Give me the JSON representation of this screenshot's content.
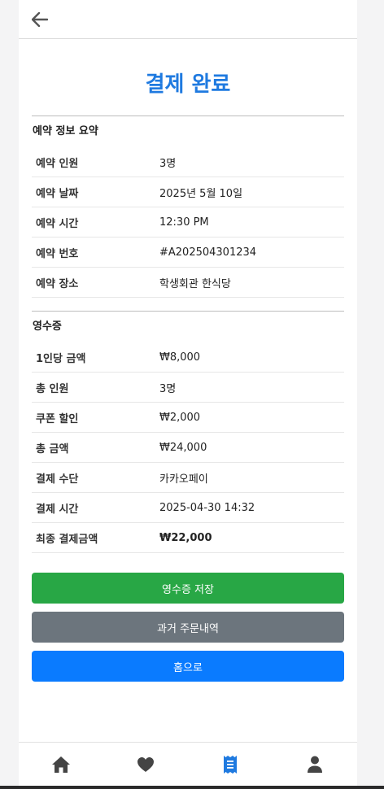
{
  "header": {
    "back_icon": "arrow-left-icon"
  },
  "page": {
    "title": "결제 완료"
  },
  "reservation": {
    "title": "예약 정보 요약",
    "rows": [
      {
        "label": "예약 인원",
        "value": "3명"
      },
      {
        "label": "예약 날짜",
        "value": "2025년 5월 10일"
      },
      {
        "label": "예약 시간",
        "value": "12:30 PM"
      },
      {
        "label": "예약 번호",
        "value": "#A202504301234"
      },
      {
        "label": "예약 장소",
        "value": "학생회관 한식당"
      }
    ]
  },
  "receipt": {
    "title": "영수증",
    "rows": [
      {
        "label": "1인당 금액",
        "value": "₩8,000"
      },
      {
        "label": "총 인원",
        "value": "3명"
      },
      {
        "label": "쿠폰 할인",
        "value": "₩2,000"
      },
      {
        "label": "총 금액",
        "value": "₩24,000"
      },
      {
        "label": "결제 수단",
        "value": "카카오페이"
      },
      {
        "label": "결제 시간",
        "value": "2025-04-30 14:32"
      },
      {
        "label": "최종 결제금액",
        "value": "₩22,000"
      }
    ]
  },
  "buttons": {
    "save_receipt": "영수증 저장",
    "past_orders": "과거 주문내역",
    "home": "홈으로"
  },
  "nav": {
    "items": [
      "home-icon",
      "heart-icon",
      "receipt-icon",
      "user-icon"
    ],
    "active": "receipt-icon",
    "colors": {
      "active": "#1f7ae0",
      "inactive": "#444444"
    }
  }
}
